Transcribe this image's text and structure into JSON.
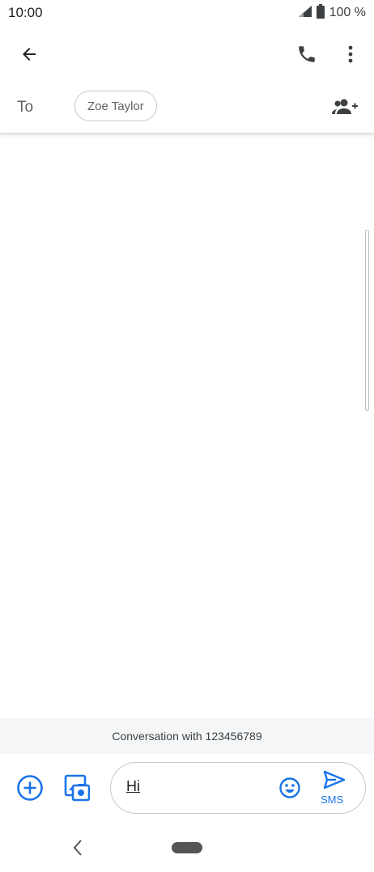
{
  "status_bar": {
    "time": "10:00",
    "battery": "100 %",
    "icons": [
      "signal-icon",
      "battery-icon"
    ]
  },
  "app_bar": {
    "icons": [
      "back-arrow-icon",
      "phone-icon",
      "more-vert-icon"
    ]
  },
  "recipient": {
    "to_label": "To",
    "chip_name": "Zoe Taylor",
    "add_icon": "add-person-icon"
  },
  "conversation": {
    "banner": "Conversation with 123456789"
  },
  "compose": {
    "text": "Hi",
    "send_label": "SMS",
    "icons": [
      "add-circle-icon",
      "gallery-icon",
      "emoji-icon",
      "send-icon"
    ]
  },
  "colors": {
    "accent": "#1a73e8",
    "icon_dark": "#3c4043"
  },
  "nav_bar": {
    "icons": [
      "nav-back-icon",
      "home-pill"
    ]
  }
}
